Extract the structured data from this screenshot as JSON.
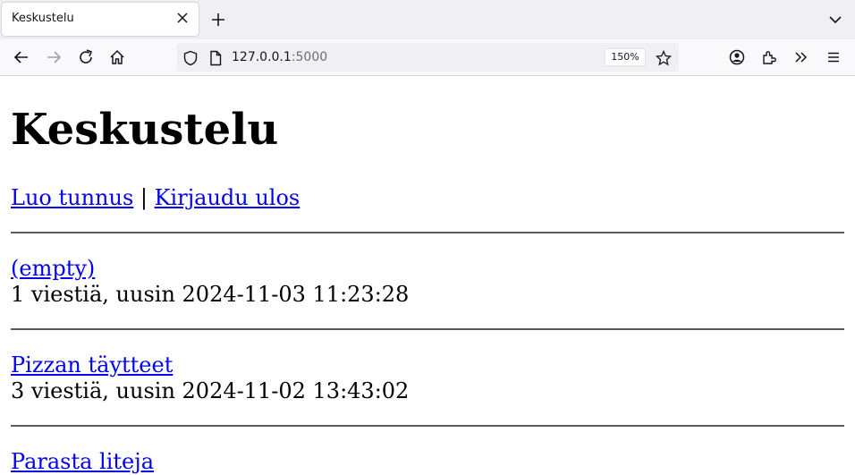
{
  "browser": {
    "tab_title": "Keskustelu",
    "url_host": "127.0.0.1",
    "url_port": ":5000",
    "zoom": "150%"
  },
  "page": {
    "heading": "Keskustelu",
    "nav": {
      "register": "Luo tunnus",
      "separator": " | ",
      "logout": "Kirjaudu ulos"
    },
    "threads": [
      {
        "title": "(empty)",
        "info": "1 viestiä, uusin 2024-11-03 11:23:28"
      },
      {
        "title": "Pizzan täytteet",
        "info": "3 viestiä, uusin 2024-11-02 13:43:02"
      },
      {
        "title": "Parasta liteja",
        "info": ""
      }
    ]
  }
}
